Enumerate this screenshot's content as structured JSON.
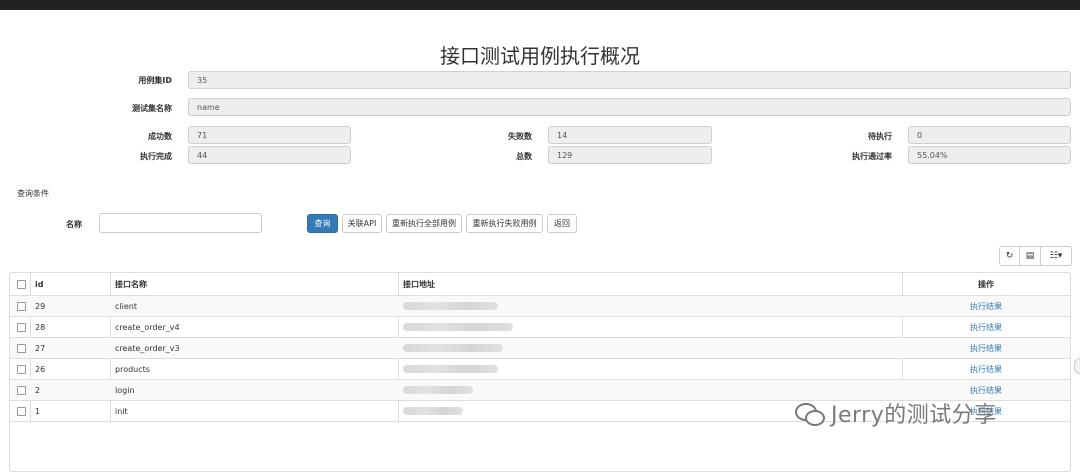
{
  "page": {
    "title": "接口测试用例执行概况"
  },
  "summary": {
    "suite_id_label": "用例集ID",
    "suite_id_value": "35",
    "suite_name_label": "测试集名称",
    "suite_name_value": "name",
    "success_label": "成功数",
    "success_value": "71",
    "fail_label": "失败数",
    "fail_value": "14",
    "pending_label": "待执行",
    "pending_value": "0",
    "done_label": "执行完成",
    "done_value": "44",
    "total_label": "总数",
    "total_value": "129",
    "pass_rate_label": "执行通过率",
    "pass_rate_value": "55.04%"
  },
  "query": {
    "section_label": "查询条件",
    "name_label": "名称",
    "name_value": "",
    "buttons": [
      "查询",
      "关联API",
      "重新执行全部用例",
      "重新执行失败用例",
      "返回"
    ]
  },
  "toolbar": {
    "refresh_icon": "refresh-icon",
    "toggle_icon": "list-toggle-icon",
    "columns_icon": "columns-icon"
  },
  "table": {
    "headers": [
      "id",
      "接口名称",
      "接口地址",
      "操作"
    ],
    "rows": [
      {
        "id": "29",
        "name": "client",
        "action": "执行结果",
        "blur_width": 95
      },
      {
        "id": "28",
        "name": "create_order_v4",
        "action": "执行结果",
        "blur_width": 110
      },
      {
        "id": "27",
        "name": "create_order_v3",
        "action": "执行结果",
        "blur_width": 100
      },
      {
        "id": "26",
        "name": "products",
        "action": "执行结果",
        "blur_width": 95
      },
      {
        "id": "2",
        "name": "login",
        "action": "执行结果",
        "blur_width": 70
      },
      {
        "id": "1",
        "name": "init",
        "action": "执行结果",
        "blur_width": 60
      }
    ]
  },
  "watermark": {
    "text": "Jerry的测试分享"
  }
}
